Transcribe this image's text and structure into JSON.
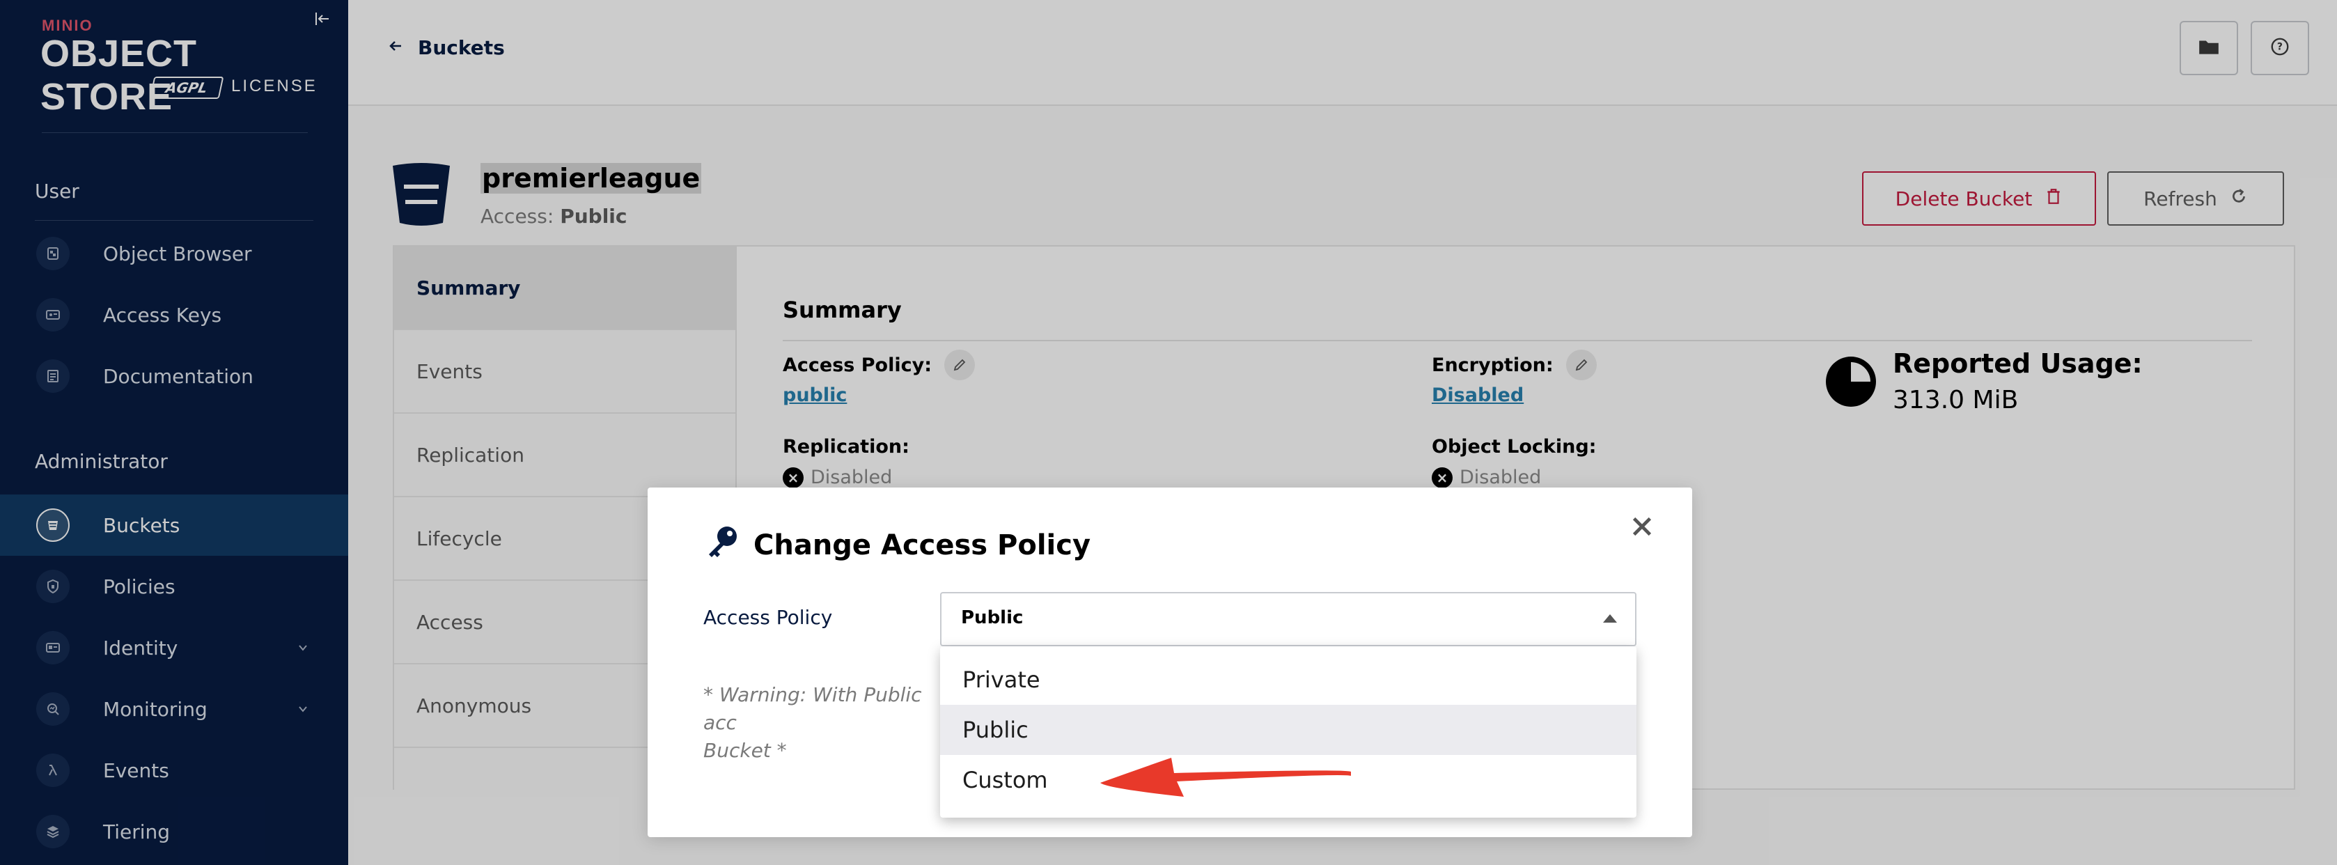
{
  "sidebar": {
    "logo": {
      "brand": "MINIO",
      "product": "OBJECT STORE",
      "badge": "AGPL",
      "license": "LICENSE"
    },
    "sections": {
      "user": "User",
      "administrator": "Administrator"
    },
    "user_items": [
      {
        "label": "Object Browser",
        "icon": "folder-browser-icon"
      },
      {
        "label": "Access Keys",
        "icon": "key-card-icon"
      },
      {
        "label": "Documentation",
        "icon": "document-icon"
      }
    ],
    "admin_items": [
      {
        "label": "Buckets",
        "icon": "bucket-icon"
      },
      {
        "label": "Policies",
        "icon": "shield-icon"
      },
      {
        "label": "Identity",
        "icon": "id-card-icon"
      },
      {
        "label": "Monitoring",
        "icon": "search-chart-icon"
      },
      {
        "label": "Events",
        "icon": "lambda-icon"
      },
      {
        "label": "Tiering",
        "icon": "layers-icon"
      }
    ]
  },
  "topbar": {
    "back_label": "Buckets"
  },
  "bucket": {
    "name": "premierleague",
    "access_prefix": "Access:",
    "access_value": "Public",
    "delete_label": "Delete Bucket",
    "refresh_label": "Refresh"
  },
  "tabs": [
    "Summary",
    "Events",
    "Replication",
    "Lifecycle",
    "Access",
    "Anonymous"
  ],
  "summary": {
    "title": "Summary",
    "access_policy_label": "Access Policy:",
    "access_policy_value": "public",
    "encryption_label": "Encryption:",
    "encryption_value": "Disabled",
    "replication_label": "Replication:",
    "replication_value": "Disabled",
    "object_locking_label": "Object Locking:",
    "object_locking_value": "Disabled",
    "usage_title": "Reported Usage:",
    "usage_value": "313.0 MiB"
  },
  "modal": {
    "title": "Change Access Policy",
    "field_label": "Access Policy",
    "selected_value": "Public",
    "warning_line1": "* Warning: With Public acc",
    "warning_line2": "Bucket *",
    "options": [
      "Private",
      "Public",
      "Custom"
    ],
    "selected_index": 1
  },
  "colors": {
    "sidebar_bg": "#081c42",
    "sidebar_active": "#113a64",
    "danger": "#c51b3f",
    "link": "#2781b0",
    "annotation_arrow": "#e8392a"
  }
}
